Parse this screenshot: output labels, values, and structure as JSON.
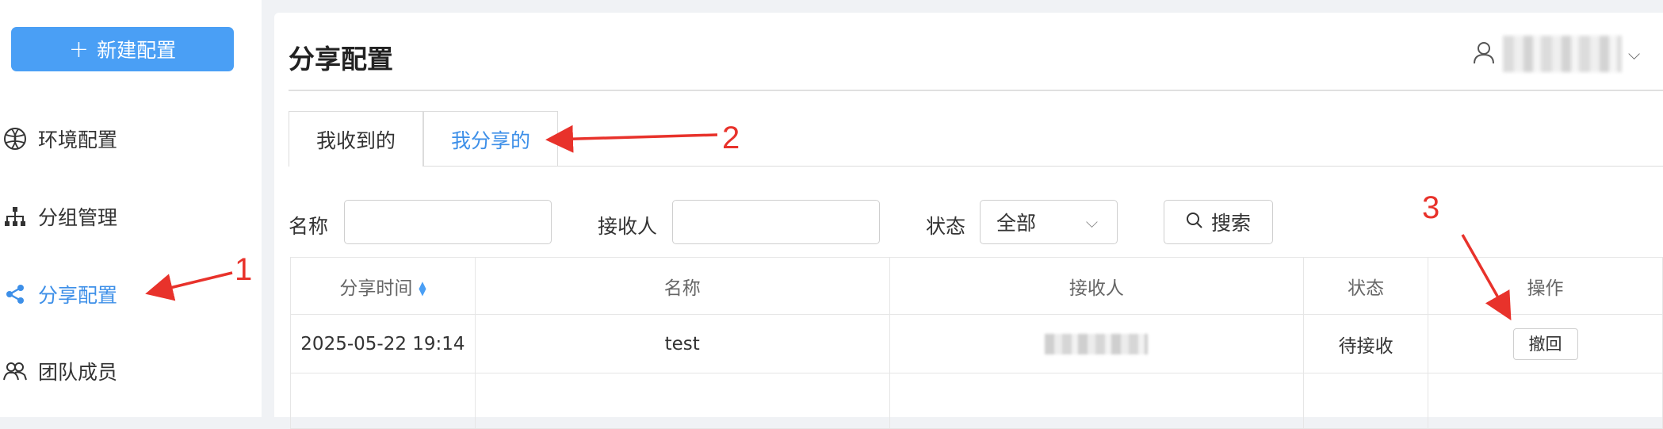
{
  "sidebar": {
    "new_button": "新建配置",
    "items": [
      {
        "label": "环境配置",
        "icon": "globe-icon"
      },
      {
        "label": "分组管理",
        "icon": "org-chart-icon"
      },
      {
        "label": "分享配置",
        "icon": "share-icon",
        "active": true
      },
      {
        "label": "团队成员",
        "icon": "team-icon"
      }
    ]
  },
  "header": {
    "title": "分享配置"
  },
  "tabs": [
    {
      "label": "我收到的",
      "active": false
    },
    {
      "label": "我分享的",
      "active": true
    }
  ],
  "filters": {
    "name_label": "名称",
    "name_value": "",
    "receiver_label": "接收人",
    "receiver_value": "",
    "status_label": "状态",
    "status_selected": "全部",
    "search_button": "搜索"
  },
  "table": {
    "columns": [
      "分享时间",
      "名称",
      "接收人",
      "状态",
      "操作"
    ],
    "rows": [
      {
        "time": "2025-05-22 19:14",
        "name": "test",
        "receiver": "",
        "status": "待接收",
        "action": "撤回"
      }
    ]
  },
  "annotations": {
    "one": "1",
    "two": "2",
    "three": "3",
    "color": "#e8322b"
  },
  "colors": {
    "accent": "#4a9ff5",
    "active_text": "#3d8fe8"
  }
}
